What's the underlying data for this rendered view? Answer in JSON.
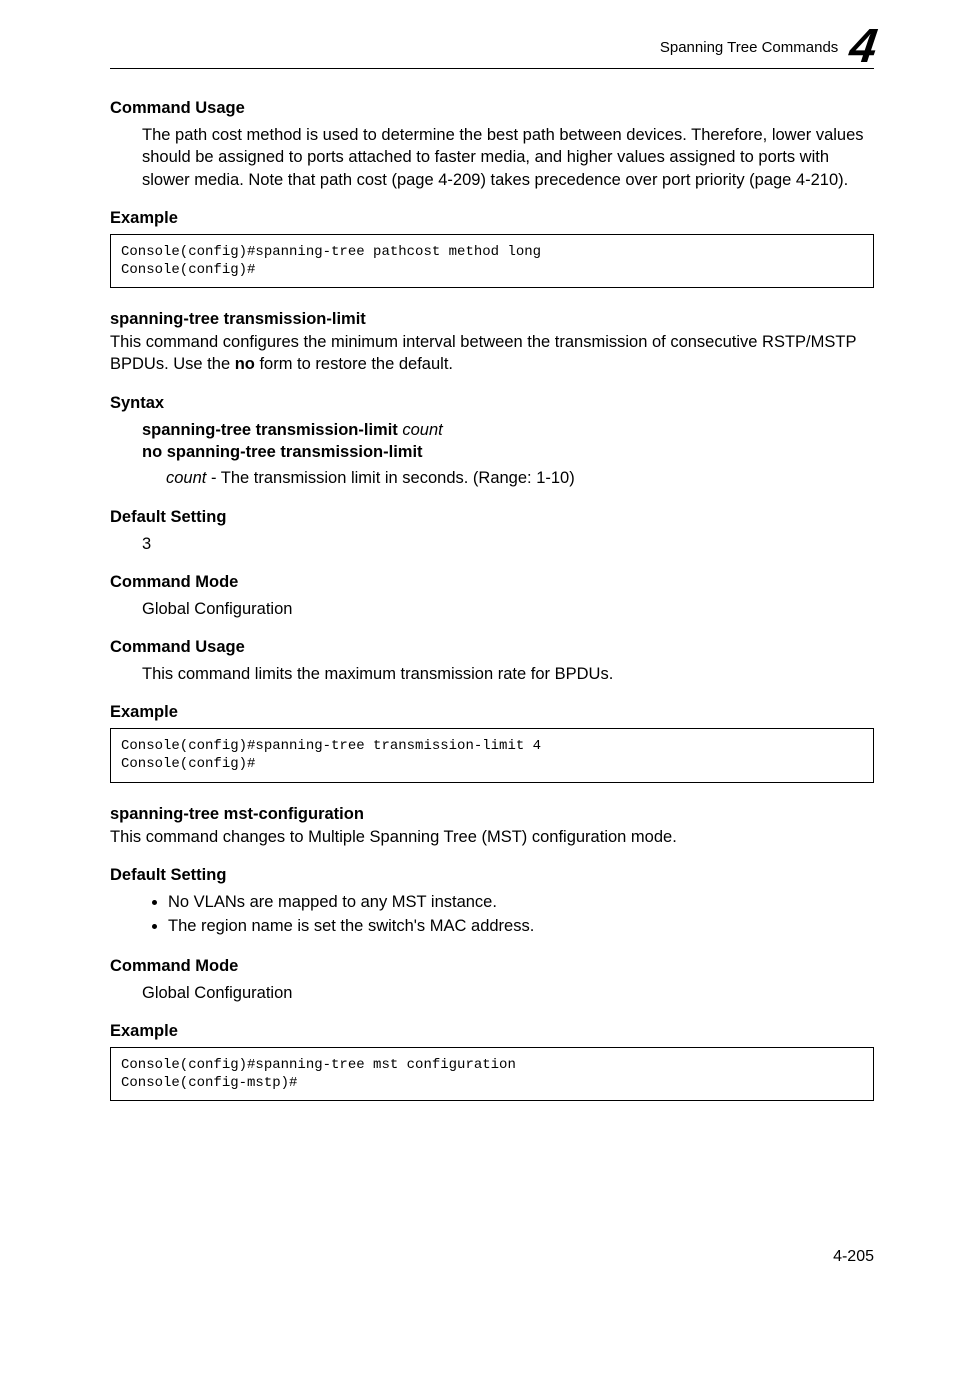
{
  "header": {
    "title": "Spanning Tree Commands",
    "chapter": "4"
  },
  "s1": {
    "heading": "Command Usage",
    "text": "The path cost method is used to determine the best path between devices. Therefore, lower values should be assigned to ports attached to faster media, and higher values assigned to ports with slower media. Note that path cost (page 4-209) takes precedence over port priority (page 4-210)."
  },
  "s2": {
    "heading": "Example",
    "code": "Console(config)#spanning-tree pathcost method long\nConsole(config)#"
  },
  "s3": {
    "heading": "spanning-tree transmission-limit",
    "text_a": "This command configures the minimum interval between the transmission of consecutive RSTP/MSTP BPDUs. Use the ",
    "text_b": "no",
    "text_c": " form to restore the default."
  },
  "s4": {
    "heading": "Syntax",
    "line1a": "spanning-tree transmission-limit ",
    "line1b": "count",
    "line2": "no spanning-tree transmission-limit",
    "arg_name": "count",
    "arg_desc": " - The transmission limit in seconds. (Range: 1-10)"
  },
  "s5": {
    "heading": "Default Setting",
    "text": "3"
  },
  "s6": {
    "heading": "Command Mode",
    "text": "Global Configuration"
  },
  "s7": {
    "heading": "Command Usage",
    "text": "This command limits the maximum transmission rate for BPDUs."
  },
  "s8": {
    "heading": "Example",
    "code": "Console(config)#spanning-tree transmission-limit 4\nConsole(config)#"
  },
  "s9": {
    "heading": "spanning-tree mst-configuration",
    "text": "This command changes to Multiple Spanning Tree (MST) configuration mode."
  },
  "s10": {
    "heading": "Default Setting",
    "item1": "No VLANs are mapped to any MST instance.",
    "item2": "The region name is set the switch's MAC address."
  },
  "s11": {
    "heading": "Command Mode",
    "text": "Global Configuration"
  },
  "s12": {
    "heading": "Example",
    "code": "Console(config)#spanning-tree mst configuration\nConsole(config-mstp)#"
  },
  "footer": {
    "page": "4-205"
  }
}
